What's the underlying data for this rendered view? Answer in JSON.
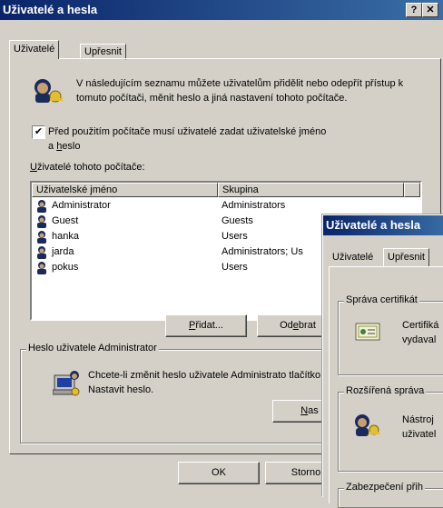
{
  "window": {
    "title": "Uživatelé a hesla",
    "help_btn": "?",
    "close_btn": "✕"
  },
  "tabs": [
    {
      "label": "Uživatelé"
    },
    {
      "label": "Upřesnit"
    }
  ],
  "intro_text": "V následujícím seznamu můžete uživatelům přidělit nebo odepřít přístup k tomuto počítači, měnit heslo a jiná nastavení tohoto počítače.",
  "checkbox": {
    "line1": "Před použitím počítače musí uživatelé zadat uživatelské jméno",
    "line2_prefix": "a ",
    "line2_u": "h",
    "line2_rest": "eslo",
    "checked": true
  },
  "users_label": {
    "u": "U",
    "rest": "živatelé tohoto počítače:"
  },
  "table": {
    "columns": [
      "Uživatelské jméno",
      "Skupina"
    ],
    "rows": [
      {
        "name": "Administrator",
        "group": "Administrators"
      },
      {
        "name": "Guest",
        "group": "Guests"
      },
      {
        "name": "hanka",
        "group": "Users"
      },
      {
        "name": "jarda",
        "group": "Administrators; Us"
      },
      {
        "name": "pokus",
        "group": "Users"
      }
    ]
  },
  "buttons": {
    "add": {
      "u": "P",
      "rest": "řidat..."
    },
    "remove": {
      "pre": "Od",
      "u": "e",
      "rest": "brat"
    },
    "ok": "OK",
    "cancel": "Storno",
    "set_password": {
      "u": "N",
      "rest": "as"
    }
  },
  "password_group": {
    "title": "Heslo uživatele Administrator",
    "text": "Chcete-li změnit heslo uživatele Administrato tlačítko Nastavit heslo."
  },
  "overlay": {
    "title": "Uživatelé a hesla",
    "tabs": [
      {
        "label": "Uživatelé"
      },
      {
        "label": "Upřesnit"
      }
    ],
    "group1": {
      "title": "Správa certifikát",
      "text": "Certifiká vydaval"
    },
    "group2": {
      "title": "Rozšířená správa",
      "text": "Nástroj uživatel"
    },
    "group3": {
      "title": "Zabezpečení přih"
    }
  },
  "colors": {
    "title_start": "#0a246a",
    "title_end": "#3a6ea5",
    "face": "#d4d0c8"
  }
}
